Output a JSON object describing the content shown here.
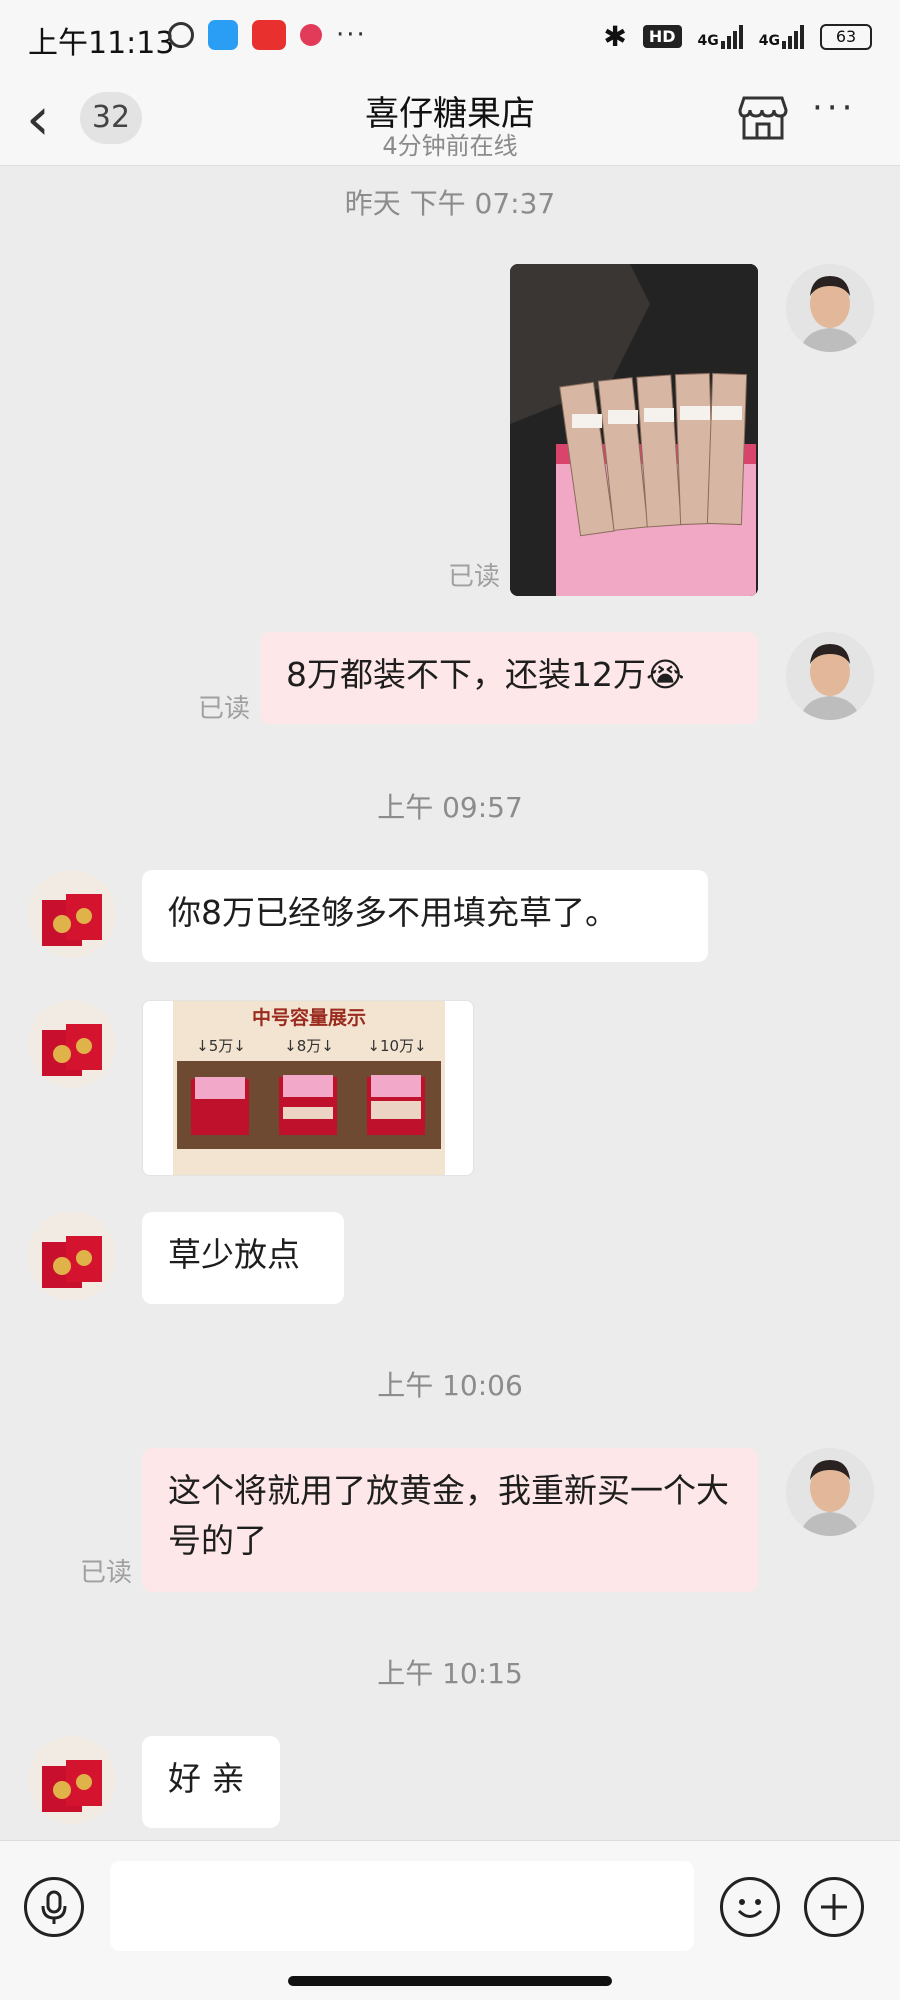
{
  "status_bar": {
    "time": "上午11:13",
    "network_label": "4G",
    "battery": "63",
    "hd_label": "HD"
  },
  "header": {
    "back_icon": "chevron-left-icon",
    "unread_count": "32",
    "title": "喜仔糖果店",
    "subtitle": "4分钟前在线",
    "store_icon": "store-icon",
    "more_label": "···"
  },
  "chat": {
    "timestamps": [
      "昨天 下午 07:37",
      "上午 09:57",
      "上午 10:06",
      "上午 10:15"
    ],
    "read_label": "已读",
    "messages": [
      {
        "sender": "me",
        "type": "image"
      },
      {
        "sender": "me",
        "type": "text",
        "text": "8万都装不下，还装12万😭"
      },
      {
        "sender": "shop",
        "type": "text",
        "text": "你8万已经够多不用填充草了。"
      },
      {
        "sender": "shop",
        "type": "image",
        "caption": "中号容量展示",
        "labels": [
          "↓5万↓",
          "↓8万↓",
          "↓10万↓"
        ]
      },
      {
        "sender": "shop",
        "type": "text",
        "text": "草少放点"
      },
      {
        "sender": "me",
        "type": "text",
        "text": "这个将就用了放黄金，我重新买一个大号的了"
      },
      {
        "sender": "shop",
        "type": "text",
        "text": "好 亲"
      }
    ]
  },
  "colors": {
    "my_bubble": "#fde7e8",
    "their_bubble": "#ffffff",
    "background": "#ececec"
  }
}
